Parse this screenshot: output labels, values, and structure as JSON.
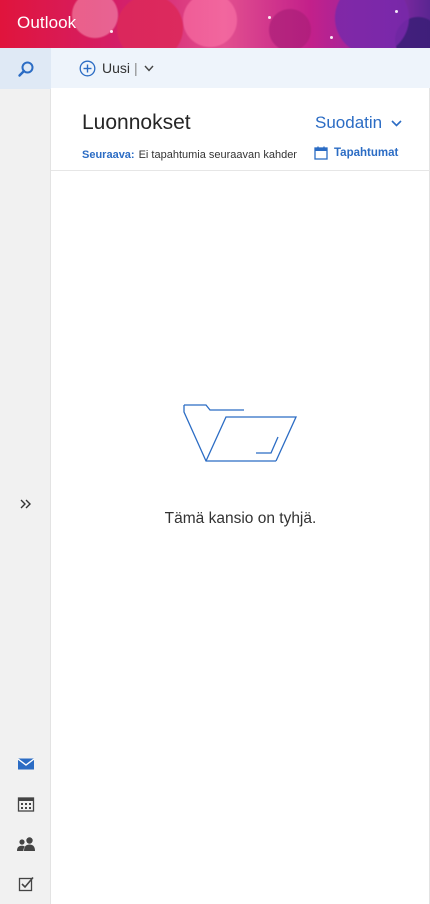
{
  "app": {
    "title": "Outlook"
  },
  "command_bar": {
    "new_label": "Uusi"
  },
  "folder": {
    "title": "Luonnokset",
    "filter_label": "Suodatin",
    "next_label": "Seuraava:",
    "next_text": "Ei tapahtumia seuraavan kahden päivän aikana",
    "events_label": "Tapahtumat",
    "empty_message": "Tämä kansio on tyhjä."
  },
  "colors": {
    "accent": "#2b6cc4",
    "rail_background": "#f1f1f1",
    "command_bar_background": "#eef4fb"
  },
  "icons": {
    "search": "search-icon",
    "new": "plus-circle-icon",
    "expand": "double-chevron-right-icon",
    "mail": "mail-icon",
    "calendar": "calendar-icon",
    "people": "people-icon",
    "tasks": "tasks-icon",
    "empty_folder": "empty-folder-icon"
  }
}
